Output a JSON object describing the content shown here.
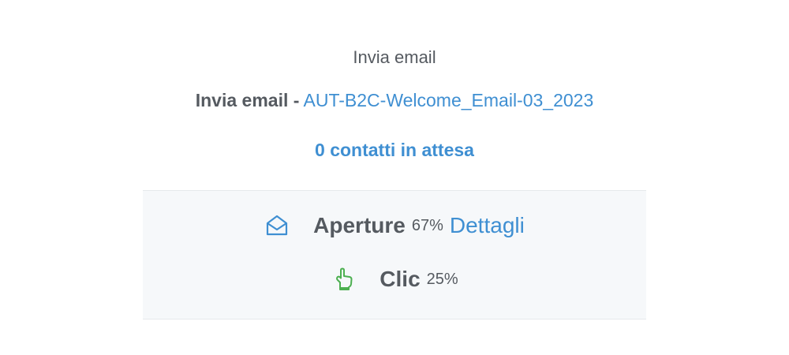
{
  "node": {
    "type_label": "Invia email",
    "title_prefix": "Invia email -",
    "title_link": "AUT-B2C-Welcome_Email-03_2023",
    "pending_contacts": "0 contatti in attesa"
  },
  "stats": {
    "opens": {
      "icon": "envelope-open-icon",
      "label": "Aperture",
      "value": "67%",
      "link": "Dettagli"
    },
    "clicks": {
      "icon": "pointer-hand-icon",
      "label": "Clic",
      "value": "25%"
    }
  },
  "colors": {
    "accent": "#3f8fd2",
    "text": "#555a60",
    "click_icon": "#4caf50",
    "panel_bg": "#f6f8fa"
  }
}
